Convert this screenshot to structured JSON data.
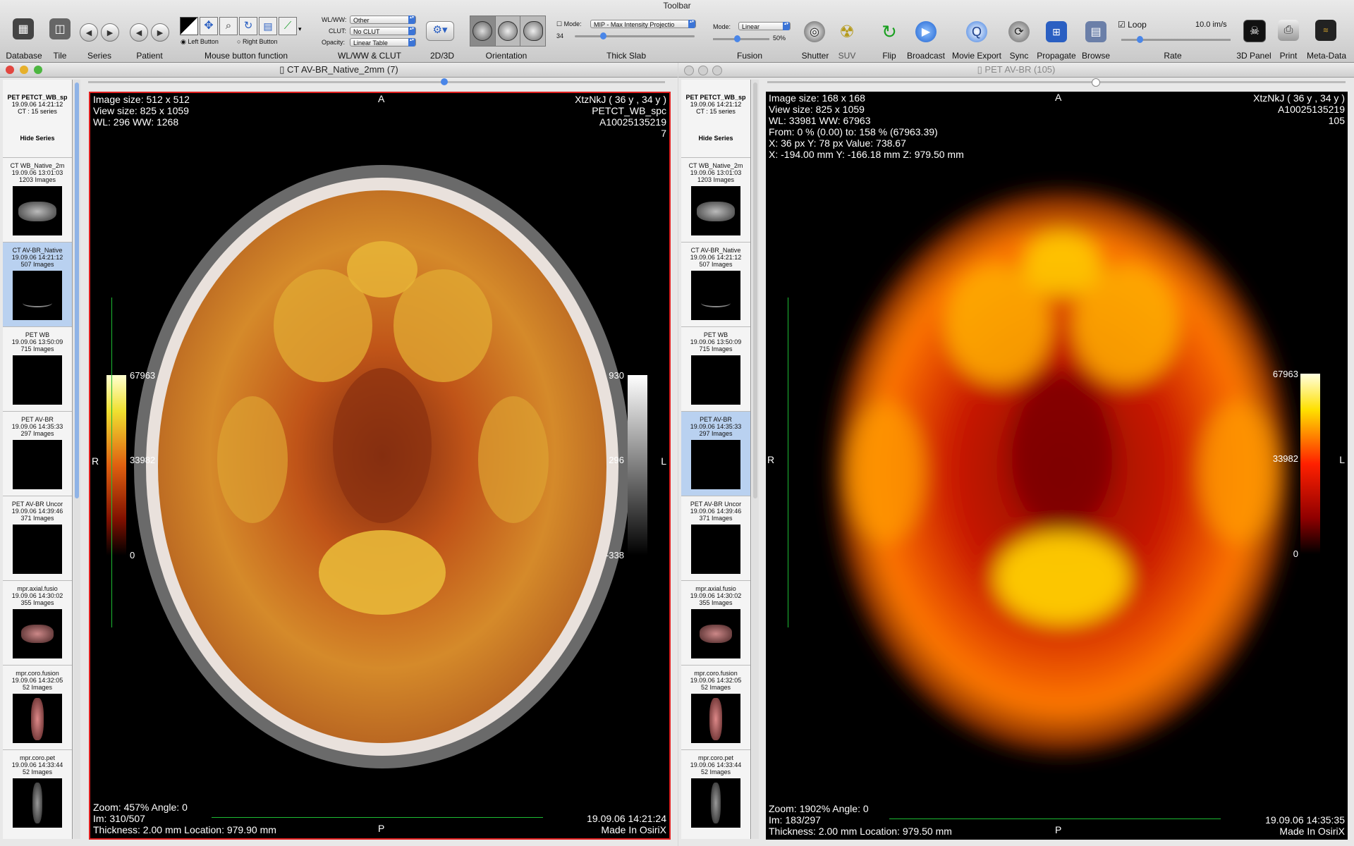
{
  "toolbar": {
    "title": "Toolbar",
    "labels": {
      "database": "Database",
      "tile": "Tile",
      "series": "Series",
      "patient": "Patient",
      "mouse_fn": "Mouse button function",
      "wlww_clut": "WL/WW & CLUT",
      "twod3d": "2D/3D",
      "orientation": "Orientation",
      "thick_slab": "Thick Slab",
      "fusion": "Fusion",
      "shutter": "Shutter",
      "suv": "SUV",
      "flip": "Flip",
      "broadcast": "Broadcast",
      "movie_export": "Movie Export",
      "sync": "Sync",
      "propagate": "Propagate",
      "browse": "Browse",
      "rate": "Rate",
      "panel3d": "3D Panel",
      "print": "Print",
      "metadata": "Meta-Data"
    },
    "left_button": "Left Button",
    "right_button": "Right Button",
    "wlww_label": "WL/WW:",
    "wlww_value": "Other",
    "clut_label": "CLUT:",
    "clut_value": "No CLUT",
    "opacity_label": "Opacity:",
    "opacity_value": "Linear Table",
    "slab_mode_label": "Mode:",
    "slab_mode_value": "MIP - Max Intensity Projectio",
    "slab_value": "34",
    "fusion_mode_label": "Mode:",
    "fusion_mode_value": "Linear",
    "fusion_percent": "50%",
    "loop_label": "Loop",
    "rate_value": "10.0 im/s"
  },
  "left_window": {
    "title": "CT AV-BR_Native_2mm (7)",
    "overlay": {
      "tl1": "Image size: 512 x 512",
      "tl2": "View size: 825 x 1059",
      "tl3": "WL: 296 WW: 1268",
      "tr1": "XtzNkJ ( 36 y , 34 y )",
      "tr2": "PETCT_WB_spc",
      "tr3": "A10025135219",
      "tr4": "7",
      "bl1": "Zoom: 457% Angle: 0",
      "bl2": "Im: 310/507",
      "bl3": "Thickness: 2.00 mm Location: 979.90 mm",
      "br1": "19.09.06 14:21:24",
      "br2": "Made In OsiriX",
      "top": "A",
      "bottom": "P",
      "left": "R",
      "right": "L",
      "pet_max": "67963",
      "pet_mid": "33982",
      "pet_min": "0",
      "ct_max": "930",
      "ct_mid": "296",
      "ct_min": "-338"
    }
  },
  "right_window": {
    "title": "PET AV-BR (105)",
    "overlay": {
      "tl1": "Image size: 168 x 168",
      "tl2": "View size: 825 x 1059",
      "tl3": "WL: 33981 WW: 67963",
      "tl4": "From: 0 % (0.00) to: 158 % (67963.39)",
      "tl5": "X: 36 px Y: 78 px Value: 738.67",
      "tl6": "X: -194.00 mm Y: -166.18 mm Z: 979.50 mm",
      "tr1": "XtzNkJ ( 36 y , 34 y )",
      "tr2": "A10025135219",
      "tr3": "105",
      "bl1": "Zoom: 1902% Angle: 0",
      "bl2": "Im: 183/297",
      "bl3": "Thickness: 2.00 mm Location: 979.50 mm",
      "br1": "19.09.06 14:35:35",
      "br2": "Made In OsiriX",
      "top": "A",
      "bottom": "P",
      "left": "R",
      "right": "L",
      "pet_max": "67963",
      "pet_mid": "33982",
      "pet_min": "0"
    }
  },
  "sidebar": {
    "study_name": "PET PETCT_WB_sp",
    "study_date": "19.09.06 14:21:12",
    "study_count": "CT : 15 series",
    "hide_series": "Hide Series",
    "items": [
      {
        "name": "CT WB_Native_2m",
        "date": "19.09.06 13:01:03",
        "count": "1203 Images"
      },
      {
        "name": "CT AV-BR_Native",
        "date": "19.09.06 14:21:12",
        "count": "507 Images"
      },
      {
        "name": "PET WB",
        "date": "19.09.06 13:50:09",
        "count": "715 Images"
      },
      {
        "name": "PET AV-BR",
        "date": "19.09.06 14:35:33",
        "count": "297 Images"
      },
      {
        "name": "PET AV-BR Uncor",
        "date": "19.09.06 14:39:46",
        "count": "371 Images"
      },
      {
        "name": "mpr.axial.fusio",
        "date": "19.09.06 14:30:02",
        "count": "355 Images"
      },
      {
        "name": "mpr.coro.fusion",
        "date": "19.09.06 14:32:05",
        "count": "52 Images"
      },
      {
        "name": "mpr.coro.pet",
        "date": "19.09.06 14:33:44",
        "count": "52 Images"
      }
    ]
  },
  "colors": {
    "selected_window_border": "#e02020",
    "ruler": "#1dbb33",
    "selection": "#b9d1f0"
  }
}
